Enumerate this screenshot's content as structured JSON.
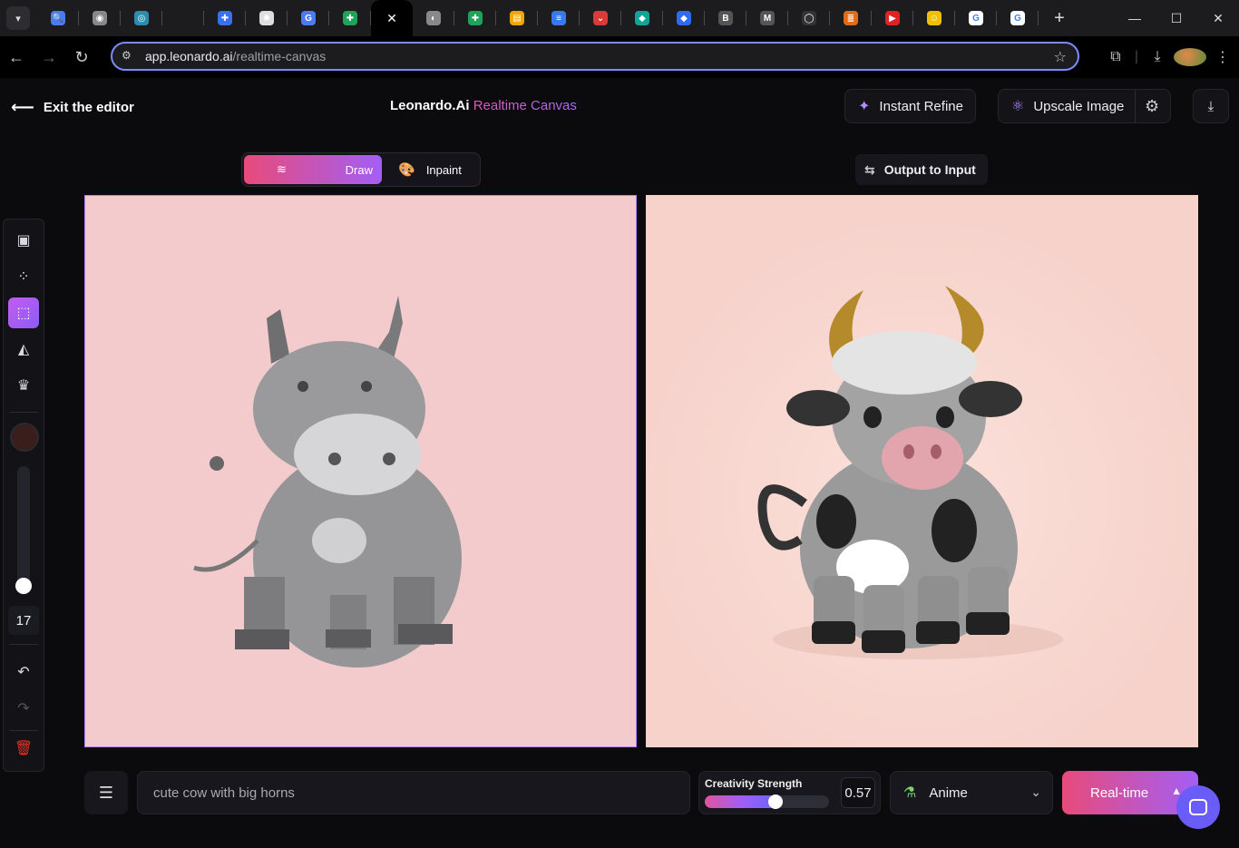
{
  "browser": {
    "tab_menu_icon": "chevron-down-icon",
    "tabs": [
      {
        "icon": "search-icon",
        "color": "#4a7cf0"
      },
      {
        "icon": "circle-logo-icon",
        "color": "#888"
      },
      {
        "icon": "eye-icon",
        "color": "#2d8bb0"
      },
      {
        "icon": "blank-icon",
        "color": "#1c1c1f"
      },
      {
        "icon": "puzzle-icon",
        "color": "#3a6ff0"
      },
      {
        "icon": "openai-icon",
        "color": "#ddd"
      },
      {
        "icon": "translate-icon",
        "color": "#4a7cf0"
      },
      {
        "icon": "cross-green-icon",
        "color": "#1fa35a"
      },
      {
        "icon": "globe-icon",
        "color": "#888"
      },
      {
        "icon": "cross-green-icon",
        "color": "#1fa35a"
      },
      {
        "icon": "folder-icon",
        "color": "#f0a500"
      },
      {
        "icon": "docs-icon",
        "color": "#3b78f0"
      },
      {
        "icon": "pin-icon",
        "color": "#d93a3a"
      },
      {
        "icon": "diamond-icon",
        "color": "#11a596"
      },
      {
        "icon": "diamond-blue-icon",
        "color": "#2f6af0"
      },
      {
        "icon": "b-icon",
        "color": "#555"
      },
      {
        "icon": "m-icon",
        "color": "#555"
      },
      {
        "icon": "github-icon",
        "color": "#333"
      },
      {
        "icon": "stack-icon",
        "color": "#e06c1a"
      },
      {
        "icon": "youtube-icon",
        "color": "#e02222"
      },
      {
        "icon": "smiley-icon",
        "color": "#f0c000"
      },
      {
        "icon": "google-icon",
        "color": "#ffffff"
      },
      {
        "icon": "google-icon",
        "color": "#ffffff"
      }
    ],
    "url_host": "app.leonardo.ai",
    "url_path": "/realtime-canvas"
  },
  "header": {
    "exit_label": "Exit the editor",
    "brand_name": "Leonardo.Ai",
    "brand_product": "Realtime Canvas",
    "instant_refine_label": "Instant Refine",
    "upscale_label": "Upscale Image"
  },
  "modes": {
    "draw_label": "Draw",
    "inpaint_label": "Inpaint",
    "output_to_input_label": "Output to Input"
  },
  "tools": {
    "brush_color": "#3a1e1c",
    "brush_size": "17"
  },
  "bottom": {
    "prompt_placeholder": "cute cow with big horns",
    "creativity_label": "Creativity Strength",
    "creativity_value": "0.57",
    "creativity_level": 0.57,
    "style_label": "Anime",
    "generate_label": "Real-time"
  },
  "colors": {
    "accent_pink": "#e84b7a",
    "accent_purple": "#a35ef5",
    "canvas_bg": "#f4cbcd"
  }
}
